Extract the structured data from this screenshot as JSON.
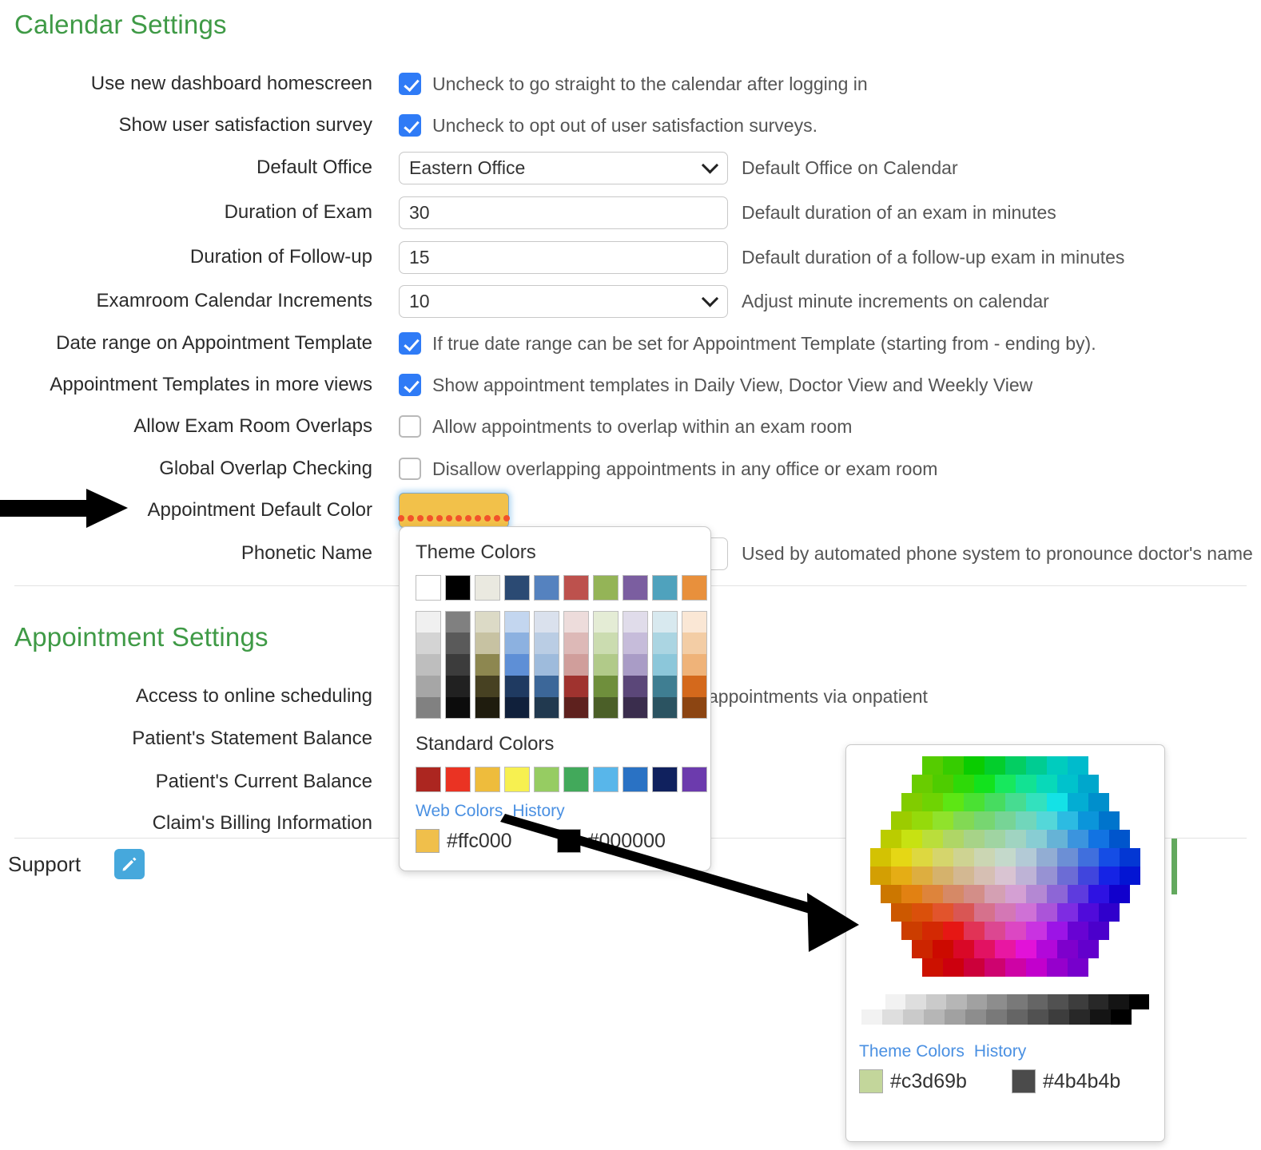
{
  "sections": {
    "calendar": {
      "title": "Calendar Settings"
    },
    "appointment": {
      "title": "Appointment Settings"
    }
  },
  "calendar_rows": [
    {
      "label": "Use new dashboard homescreen",
      "type": "checkbox",
      "checked": true,
      "hint": "Uncheck to go straight to the calendar after logging in"
    },
    {
      "label": "Show user satisfaction survey",
      "type": "checkbox",
      "checked": true,
      "hint": "Uncheck to opt out of user satisfaction surveys."
    },
    {
      "label": "Default Office",
      "type": "select",
      "value": "Eastern Office",
      "hint": "Default Office on Calendar"
    },
    {
      "label": "Duration of Exam",
      "type": "text",
      "value": "30",
      "hint": "Default duration of an exam in minutes"
    },
    {
      "label": "Duration of Follow-up",
      "type": "text",
      "value": "15",
      "hint": "Default duration of a follow-up exam in minutes"
    },
    {
      "label": "Examroom Calendar Increments",
      "type": "select",
      "value": "10",
      "hint": "Adjust minute increments on calendar"
    },
    {
      "label": "Date range on Appointment Template",
      "type": "checkbox",
      "checked": true,
      "hint": "If true date range can be set for Appointment Template (starting from - ending by)."
    },
    {
      "label": "Appointment Templates in more views",
      "type": "checkbox",
      "checked": true,
      "hint": "Show appointment templates in Daily View, Doctor View and Weekly View"
    },
    {
      "label": "Allow Exam Room Overlaps",
      "type": "checkbox",
      "checked": false,
      "hint": "Allow appointments to overlap within an exam room"
    },
    {
      "label": "Global Overlap Checking",
      "type": "checkbox",
      "checked": false,
      "hint": "Disallow overlapping appointments in any office or exam room"
    },
    {
      "label": "Appointment Default Color",
      "type": "color",
      "value": "#ffc000",
      "hint": ""
    },
    {
      "label": "Phonetic Name",
      "type": "text",
      "value": "",
      "hint": "Used by automated phone system to pronounce doctor's name"
    }
  ],
  "appointment_rows": [
    {
      "label": "Access to online scheduling",
      "hint": "appointments via onpatient"
    },
    {
      "label": "Patient's Statement Balance",
      "hint": ""
    },
    {
      "label": "Patient's Current Balance",
      "hint": ""
    },
    {
      "label": "Claim's Billing Information",
      "hint": ""
    }
  ],
  "color_picker": {
    "theme_heading": "Theme Colors",
    "standard_heading": "Standard Colors",
    "link_web_colors": "Web Colors",
    "link_history": "History",
    "history": [
      {
        "hex": "#ffc000",
        "swatch": "#f0bf4b"
      },
      {
        "hex": "#000000",
        "swatch": "#000000"
      }
    ],
    "theme_base": [
      "#ffffff",
      "#000000",
      "#eae9e0",
      "#2b4a73",
      "#5582bf",
      "#bd514d",
      "#94b457",
      "#7b5ea0",
      "#4fa2bd",
      "#e8903c"
    ],
    "theme_tints": [
      [
        "#f0f0f0",
        "#d4d4d4",
        "#bebebe",
        "#a6a6a6",
        "#818181"
      ],
      [
        "#808080",
        "#5a5a5a",
        "#3c3c3c",
        "#212121",
        "#0c0c0c"
      ],
      [
        "#dcdac6",
        "#c7c2a2",
        "#8d8750",
        "#474122",
        "#1f1c0e"
      ],
      [
        "#c3d6ef",
        "#8cb1e0",
        "#5e8fd6",
        "#1f3a61",
        "#10203b"
      ],
      [
        "#dae1ed",
        "#bacde4",
        "#9ebbdc",
        "#3c6799",
        "#21394f"
      ],
      [
        "#eddcdb",
        "#ddb9b7",
        "#d09e9b",
        "#a0332f",
        "#5e211e"
      ],
      [
        "#e4ecd5",
        "#cbdcb0",
        "#b1ca89",
        "#6f8f3c",
        "#4b5f28"
      ],
      [
        "#e0dcea",
        "#c6bcda",
        "#a99cc6",
        "#5b4779",
        "#3a2d4d"
      ],
      [
        "#d8e9ef",
        "#abd5e2",
        "#8cc7da",
        "#3f7e92",
        "#2b5361"
      ],
      [
        "#fae7d5",
        "#f3cda5",
        "#efb379",
        "#d4691c",
        "#8c4512"
      ]
    ],
    "standard": [
      "#ac2620",
      "#ea3323",
      "#eebc3c",
      "#f7f050",
      "#96cc62",
      "#42a95b",
      "#58b6ea",
      "#2a72c4",
      "#10215e",
      "#6c3bad"
    ]
  },
  "web_picker": {
    "link_theme_colors": "Theme Colors",
    "link_history": "History",
    "history": [
      {
        "hex": "#c3d69b",
        "swatch": "#c3d69b"
      },
      {
        "hex": "#4b4b4b",
        "swatch": "#4b4b4b"
      }
    ]
  },
  "support": {
    "label": "Support",
    "icon": "pencil-icon"
  },
  "icons": {
    "chevron_down": "chevron-down-icon",
    "checkmark": "check-icon",
    "arrow": "arrow-pointer-icon"
  },
  "colors": {
    "heading_green": "#3f9a46",
    "checkbox_blue": "#2f7bf6",
    "link_blue": "#4a90e2",
    "selected_color": "#f2c14a"
  }
}
